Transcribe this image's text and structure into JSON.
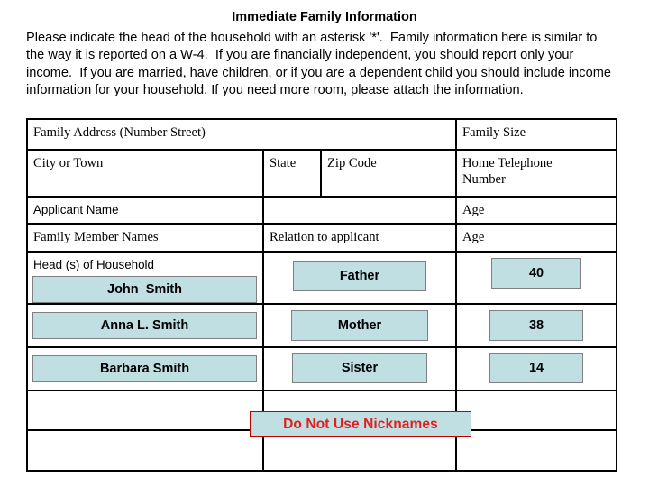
{
  "document": {
    "title": "Immediate Family Information",
    "intro": "Please indicate the head of the household with an asterisk '*'.  Family information here is similar to the way it is reported on a W-4.  If you are financially independent, you should report only your income.  If you are married, have children, or if you are a dependent child you should include income information for your household. If you need more room, please attach the information."
  },
  "table": {
    "row1": {
      "address_label": "Family Address (Number Street)",
      "family_size_label": "Family Size"
    },
    "row2": {
      "city_label": "City or Town",
      "state_label": "State",
      "zip_label": "Zip Code",
      "phone_label": "Home Telephone\nNumber"
    },
    "row3": {
      "applicant_name_label": "Applicant Name",
      "middle_label": "",
      "age_label": "Age"
    },
    "row4": {
      "family_member_names_label": "Family Member Names",
      "relation_label": "Relation to applicant",
      "age_label": "Age"
    },
    "row5": {
      "head_of_household_label": "Head (s) of Household",
      "name_value": "John  Smith",
      "relation_value": "Father",
      "age_value": "40"
    },
    "row6": {
      "name_value": "Anna L. Smith",
      "relation_value": "Mother",
      "age_value": "38"
    },
    "row7": {
      "name_value": "Barbara Smith",
      "relation_value": "Sister",
      "age_value": "14"
    },
    "row8": {
      "name_value": "",
      "relation_value": "",
      "age_value": ""
    },
    "row9": {
      "name_value": "",
      "relation_value": "",
      "age_value": ""
    }
  },
  "callout": {
    "warning_text": "Do Not Use Nicknames",
    "warning_color": "#e02020",
    "warning_bg": "#bfdfe3",
    "warning_border": "#c00000"
  },
  "style": {
    "highlight_bg": "#bfdfe3",
    "highlight_border": "#808080",
    "table_border": "#000000"
  }
}
